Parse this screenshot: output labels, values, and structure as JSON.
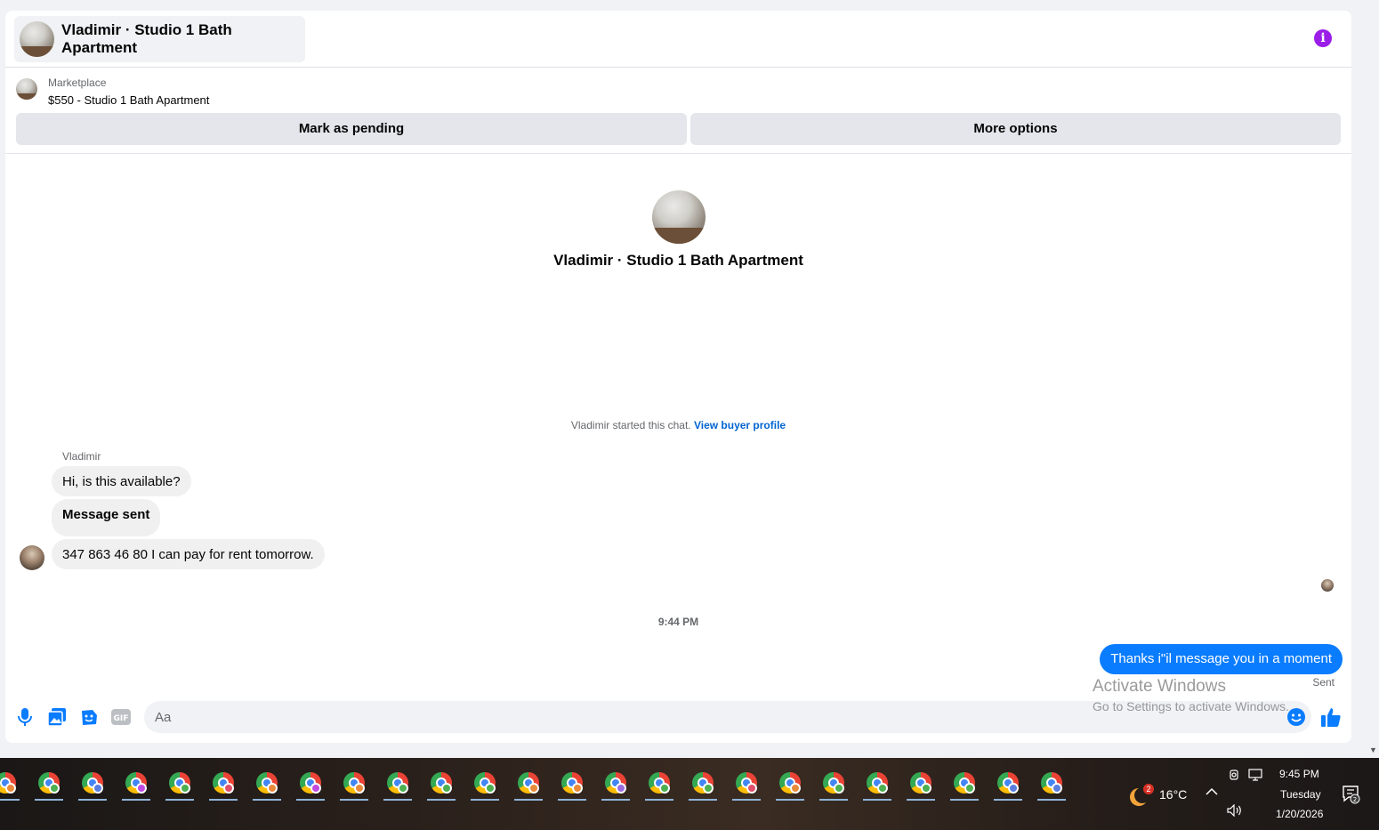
{
  "header": {
    "title": "Vladimir · Studio 1 Bath Apartment"
  },
  "listing": {
    "source": "Marketplace",
    "price_title": "$550 - Studio 1 Bath Apartment",
    "pending_label": "Mark as pending",
    "more_label": "More options"
  },
  "intro": {
    "title": "Vladimir · Studio 1 Bath Apartment",
    "started_text": "Vladimir started this chat.",
    "profile_link": "View buyer profile"
  },
  "messages": {
    "sender": "Vladimir",
    "incoming": [
      "Hi, is this available?",
      "Message sent",
      "347 863 46 80 I can pay for rent tomorrow."
    ],
    "timestamp": "9:44 PM",
    "outgoing": "Thanks i\"il message you in a moment",
    "status": "Sent"
  },
  "watermark": {
    "title": "Activate Windows",
    "subtitle": "Go to Settings to activate Windows."
  },
  "composer": {
    "placeholder": "Aa"
  },
  "taskbar": {
    "weather_badge": "2",
    "temperature": "16°C",
    "time": "9:45 PM",
    "day": "Tuesday",
    "date": "1/20/2026",
    "notification_count": "2",
    "app_badge_colors": [
      "#e88a3a",
      "#4caf50",
      "#5a7de0",
      "#c04be0",
      "#4caf50",
      "#e0506a",
      "#e88a3a",
      "#c04be0",
      "#e88a3a",
      "#4caf50",
      "#4caf50",
      "#4caf50",
      "#e88a3a",
      "#e88a3a",
      "#9b6be0",
      "#4caf50",
      "#4caf50",
      "#e0506a",
      "#e88a3a",
      "#4caf50",
      "#4caf50",
      "#4caf50",
      "#4caf50",
      "#5a7de0",
      "#5a7de0"
    ]
  },
  "colors": {
    "accent": "#0a7cff",
    "info": "#9b1de8",
    "link": "#0064d1"
  }
}
